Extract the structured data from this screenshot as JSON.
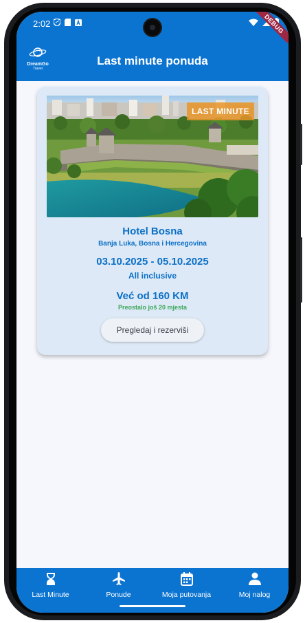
{
  "status_bar": {
    "time": "2:02",
    "debug_label": "DEBUG"
  },
  "app_bar": {
    "logo_name": "DreamGo",
    "logo_sub": "Travel",
    "title": "Last minute ponuda"
  },
  "offer": {
    "badge": "LAST MINUTE",
    "hotel_name": "Hotel Bosna",
    "location": "Banja Luka, Bosna i Hercegovina",
    "dates": "03.10.2025 - 05.10.2025",
    "board": "All inclusive",
    "price": "Već od 160 KM",
    "spots_left": "Preostalo još 20 mjesta",
    "button_label": "Pregledaj i rezerviši"
  },
  "bottom_nav": {
    "items": [
      {
        "label": "Last Minute",
        "icon": "hourglass-icon"
      },
      {
        "label": "Ponude",
        "icon": "airplane-icon"
      },
      {
        "label": "Moja putovanja",
        "icon": "calendar-icon"
      },
      {
        "label": "Moj nalog",
        "icon": "person-icon"
      }
    ]
  },
  "colors": {
    "primary": "#0b74d1",
    "card_bg": "#dde9f7",
    "accent_text": "#0b6fc6",
    "success": "#3aa757",
    "badge": "#e89428"
  }
}
